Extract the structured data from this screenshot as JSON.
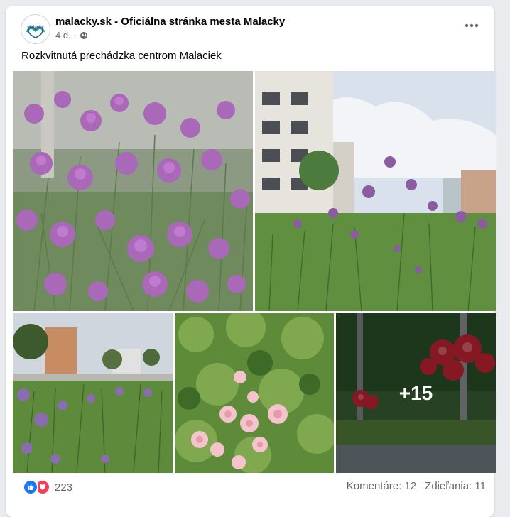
{
  "post": {
    "page_name": "malacky.sk - Oficiálna stránka mesta Malacky",
    "time": "4 d.",
    "privacy_icon": "globe-icon",
    "text": "Rozkvitnutá prechádzka centrom Malaciek",
    "avatar_text": "Malacky",
    "more_photos": "+15"
  },
  "footer": {
    "reaction_count": "223",
    "comments": "Komentáre: 12",
    "shares": "Zdieľania: 11"
  },
  "colors": {
    "like": "#1877f2",
    "love": "#f33e58",
    "flower_purple": "#a063b8",
    "rose_pink": "#f2b6c0",
    "geranium_red": "#d8283a"
  }
}
